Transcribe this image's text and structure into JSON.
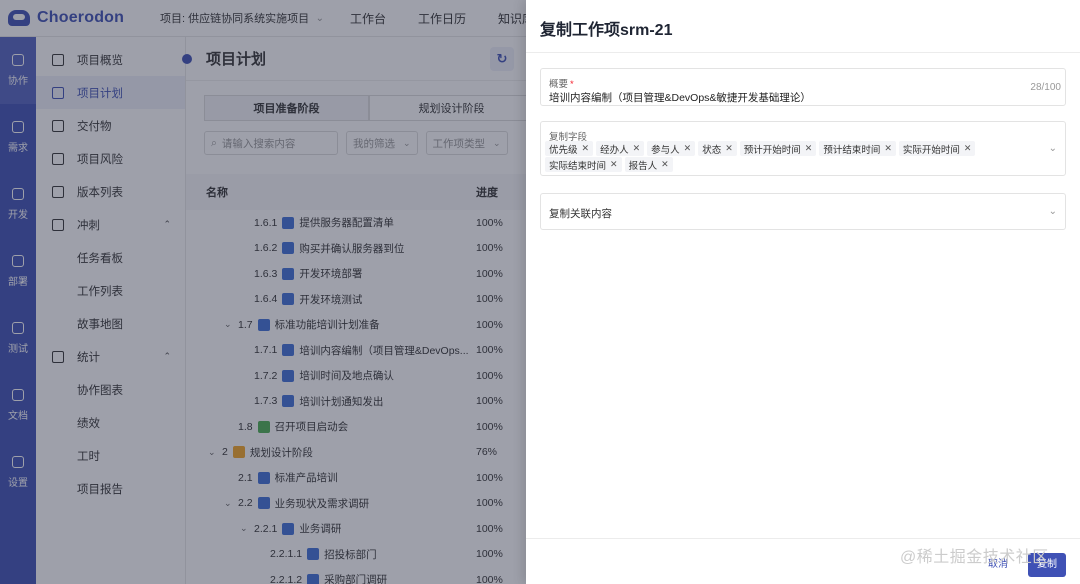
{
  "app": {
    "logo_text": "Choerodon",
    "project_select": "项目: 供应链协同系统实施项目",
    "top_nav": [
      "工作台",
      "工作日历",
      "知识库"
    ],
    "rail": [
      {
        "label": "协作",
        "icon": "collaboration-icon"
      },
      {
        "label": "需求",
        "icon": "requirement-icon"
      },
      {
        "label": "开发",
        "icon": "code-icon"
      },
      {
        "label": "部署",
        "icon": "deploy-icon"
      },
      {
        "label": "测试",
        "icon": "test-icon"
      },
      {
        "label": "文档",
        "icon": "document-icon"
      },
      {
        "label": "设置",
        "icon": "settings-icon"
      }
    ],
    "menu": [
      {
        "label": "项目概览",
        "icon": "chart-icon"
      },
      {
        "label": "项目计划",
        "icon": "tree-icon",
        "active": true
      },
      {
        "label": "交付物",
        "icon": "file-icon"
      },
      {
        "label": "项目风险",
        "icon": "risk-icon"
      },
      {
        "label": "版本列表",
        "icon": "list-icon"
      },
      {
        "label": "冲刺",
        "icon": "sprint-icon",
        "group": true
      },
      {
        "label": "任务看板",
        "sub": true
      },
      {
        "label": "工作列表",
        "sub": true
      },
      {
        "label": "故事地图",
        "sub": true
      },
      {
        "label": "统计",
        "icon": "pie-icon",
        "group": true
      },
      {
        "label": "协作图表",
        "sub": true
      },
      {
        "label": "绩效",
        "sub": true
      },
      {
        "label": "工时",
        "sub": true
      },
      {
        "label": "项目报告",
        "sub": true
      }
    ],
    "page_title": "项目计划",
    "stages": [
      "项目准备阶段",
      "规划设计阶段"
    ],
    "search_placeholder": "请输入搜索内容",
    "filters": [
      "我的筛选",
      "工作项类型"
    ],
    "table_headers": {
      "name": "名称",
      "progress": "进度"
    },
    "rows": [
      {
        "indent": 2,
        "num": "1.6.1",
        "text": "提供服务器配置清单",
        "pct": "100%",
        "icon_color": "#3f6fd8"
      },
      {
        "indent": 2,
        "num": "1.6.2",
        "text": "购买并确认服务器到位",
        "pct": "100%",
        "icon_color": "#3f6fd8"
      },
      {
        "indent": 2,
        "num": "1.6.3",
        "text": "开发环境部署",
        "pct": "100%",
        "icon_color": "#3f6fd8"
      },
      {
        "indent": 2,
        "num": "1.6.4",
        "text": "开发环境测试",
        "pct": "100%",
        "icon_color": "#3f6fd8"
      },
      {
        "indent": 1,
        "toggle": "⌄",
        "num": "1.7",
        "text": "标准功能培训计划准备",
        "pct": "100%",
        "icon_color": "#3f6fd8"
      },
      {
        "indent": 2,
        "num": "1.7.1",
        "text": "培训内容编制（项目管理&DevOps...",
        "pct": "100%",
        "icon_color": "#3f6fd8"
      },
      {
        "indent": 2,
        "num": "1.7.2",
        "text": "培训时间及地点确认",
        "pct": "100%",
        "icon_color": "#3f6fd8"
      },
      {
        "indent": 2,
        "num": "1.7.3",
        "text": "培训计划通知发出",
        "pct": "100%",
        "icon_color": "#3f6fd8"
      },
      {
        "indent": 1,
        "num": "1.8",
        "text": "召开项目启动会",
        "pct": "100%",
        "icon_color": "#4caf50"
      },
      {
        "indent": 0,
        "toggle": "⌄",
        "num": "2",
        "text": "规划设计阶段",
        "pct": "76%",
        "icon_color": "#f5a623"
      },
      {
        "indent": 1,
        "num": "2.1",
        "text": "标准产品培训",
        "pct": "100%",
        "icon_color": "#3f6fd8"
      },
      {
        "indent": 1,
        "toggle": "⌄",
        "num": "2.2",
        "text": "业务现状及需求调研",
        "pct": "100%",
        "icon_color": "#3f6fd8"
      },
      {
        "indent": 2,
        "toggle": "⌄",
        "num": "2.2.1",
        "text": "业务调研",
        "pct": "100%",
        "icon_color": "#3f6fd8"
      },
      {
        "indent": 3,
        "num": "2.2.1.1",
        "text": "招投标部门",
        "pct": "100%",
        "icon_color": "#3f6fd8"
      },
      {
        "indent": 3,
        "num": "2.2.1.2",
        "text": "采购部门调研",
        "pct": "100%",
        "icon_color": "#3f6fd8"
      }
    ]
  },
  "drawer": {
    "title": "复制工作项srm-21",
    "summary": {
      "label": "概要",
      "value": "培训内容编制（项目管理&DevOps&敏捷开发基础理论）",
      "counter": "28/100"
    },
    "copy_fields": {
      "label": "复制字段",
      "tags": [
        "优先级",
        "经办人",
        "参与人",
        "状态",
        "预计开始时间",
        "预计结束时间",
        "实际开始时间",
        "实际结束时间",
        "报告人"
      ]
    },
    "related": {
      "label": "复制关联内容"
    },
    "cancel_label": "取消",
    "copy_label": "复制"
  },
  "watermark": "@稀土掘金技术社区",
  "colors": {
    "primary": "#3f51b5",
    "overlay": "rgba(40,44,66,0.45)"
  }
}
